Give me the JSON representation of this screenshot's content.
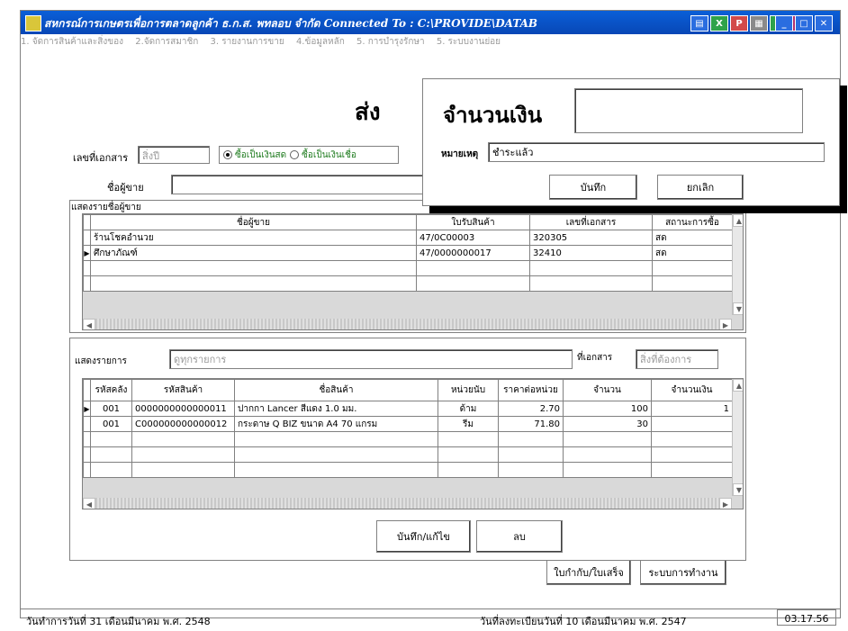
{
  "window": {
    "title": "สหกรณ์การเกษตรเพื่อการตลาดลูกค้า ธ.ก.ส. พทลอบ จำกัด   Connected To : C:\\PROVIDE\\DATAB",
    "menu": [
      "1. จัดการสินค้าและสิ่งของ",
      "2.จัดการสมาชิก",
      "3. รายงานการขาย",
      "4.ข้อมูลหลัก",
      "5. การบำรุงรักษา",
      "5. ระบบงานย่อย"
    ]
  },
  "page_title": "ส่ง",
  "form": {
    "doc_no_label": "เลขที่เอกสาร",
    "doc_no_value": "สิ่งปี",
    "radio_cash": "ซื้อเป็นเงินสด",
    "radio_credit": "ซื้อเป็นเงินเชื่อ",
    "seller_label": "ชื่อผู้ขาย",
    "seller_value": ""
  },
  "sellers_grid": {
    "caption": "แสดงรายชื่อผู้ขาย",
    "columns": [
      "ชื่อผู้ขาย",
      "ใบรับสินค้า",
      "เลขที่เอกสาร",
      "สถานะการซื้อ"
    ],
    "rows": [
      {
        "indicator": "",
        "cells": [
          "ร้านโชคอำนวย",
          "47/0C00003",
          "320305",
          "สด"
        ]
      },
      {
        "indicator": "▶",
        "cells": [
          "ศึกษาภัณฑ์",
          "47/0000000017",
          "32410",
          "สด"
        ]
      },
      {
        "indicator": "",
        "cells": [
          "",
          "",
          "",
          ""
        ]
      },
      {
        "indicator": "",
        "cells": [
          "",
          "",
          "",
          ""
        ]
      }
    ]
  },
  "items_grid": {
    "caption": "แสดงรายการ",
    "search_value": "ดูทุกรายการ",
    "doc_label": "ที่เอกสาร",
    "doc_value": "สิ่งที่ต้องการ",
    "columns": [
      "รหัสคลัง",
      "รหัสสินค้า",
      "ชื่อสินค้า",
      "หน่วยนับ",
      "ราคาต่อหน่วย",
      "จำนวน",
      "จำนวนเงิน"
    ],
    "rows": [
      {
        "indicator": "▶",
        "cells": [
          "001",
          "0000000000000011",
          "ปากกา Lancer สีแดง 1.0 มม.",
          "ด้าม",
          "2.70",
          "100",
          "1"
        ]
      },
      {
        "indicator": "",
        "cells": [
          "001",
          "C000000000000012",
          "กระดาษ Q BIZ ขนาด A4 70 แกรม",
          "รีม",
          "71.80",
          "30",
          ""
        ]
      },
      {
        "indicator": "",
        "cells": [
          "",
          "",
          "",
          "",
          "",
          "",
          ""
        ]
      },
      {
        "indicator": "",
        "cells": [
          "",
          "",
          "",
          "",
          "",
          "",
          ""
        ]
      },
      {
        "indicator": "",
        "cells": [
          "",
          "",
          "",
          "",
          "",
          "",
          ""
        ]
      }
    ]
  },
  "buttons": {
    "save_edit": "บันทึก/แก้ไข",
    "delete": "ลบ",
    "receipt": "ใบกำกับ/ใบเสร็จ",
    "report": "ระบบการทำงาน"
  },
  "popup": {
    "title": "จำนวนเงิน",
    "amount": "",
    "note_label": "หมายเหตุ",
    "note_value": "ชำระแล้ว",
    "ok": "บันทึก",
    "cancel": "ยกเลิก"
  },
  "status": {
    "left": "วันทำการวันที่ 31 เดือนมีนาคม พ.ศ. 2548",
    "middle": "วันที่ลงทะเบียนวันที่ 10 เดือนมีนาคม พ.ศ. 2547",
    "time": "03.17.56"
  },
  "colors": {
    "titlebar": "#0a5fd8",
    "accent_green": "#1d7a1d",
    "grid_border": "#808080"
  }
}
